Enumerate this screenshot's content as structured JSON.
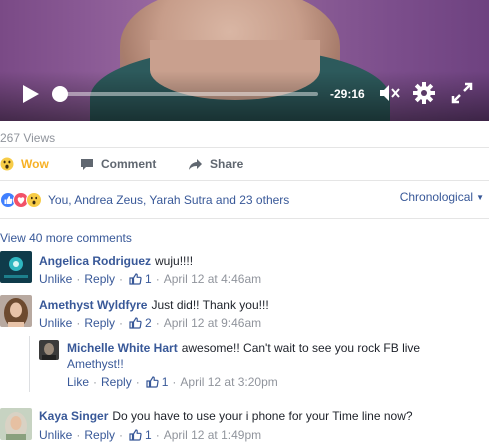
{
  "video": {
    "time_remaining": "-29:16",
    "progress_fraction": 0.0,
    "controls": [
      "play-icon",
      "mute-icon",
      "gear-icon",
      "fullscreen-icon"
    ]
  },
  "stats": {
    "views": "267 Views"
  },
  "actions": {
    "wow": "Wow",
    "comment": "Comment",
    "share": "Share"
  },
  "reactions": {
    "icons": [
      "like-icon",
      "love-icon",
      "wow-icon"
    ],
    "summary": "You, Andrea Zeus, Yarah Sutra and 23 others",
    "sort_label": "Chronological"
  },
  "comments_section": {
    "view_more": "View 40 more comments",
    "comments": [
      {
        "author": "Angelica Rodriguez",
        "text": "wuju!!!!",
        "unlike": "Unlike",
        "reply": "Reply",
        "likes": "1",
        "date": "April 12 at 4:46am"
      },
      {
        "author": "Amethyst Wyldfyre",
        "text": "Just did!! Thank you!!!",
        "unlike": "Unlike",
        "reply": "Reply",
        "likes": "2",
        "date": "April 12 at 9:46am"
      },
      {
        "author": "Michelle White Hart",
        "text_line1": "awesome!! Can't wait to see you rock FB live",
        "text_line2": "Amethyst!!",
        "like": "Like",
        "reply": "Reply",
        "likes": "1",
        "date": "April 12 at 3:20pm"
      },
      {
        "author": "Kaya Singer",
        "text": "Do you have to use your i phone for your Time line now?",
        "unlike": "Unlike",
        "reply": "Reply",
        "likes": "1",
        "date": "April 12 at 1:49pm"
      }
    ]
  },
  "colors": {
    "link": "#385898",
    "meta": "#90949c",
    "wow": "#f7b125"
  }
}
